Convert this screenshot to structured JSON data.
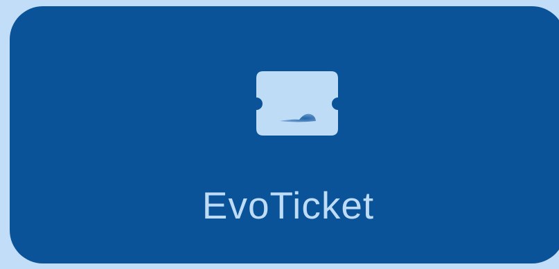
{
  "app": {
    "name": "EvoTicket"
  },
  "icon": {
    "name": "ticket-icon"
  },
  "colors": {
    "background": "#c2ddf7",
    "card": "#0a5399",
    "foreground": "#bfdcf6"
  }
}
